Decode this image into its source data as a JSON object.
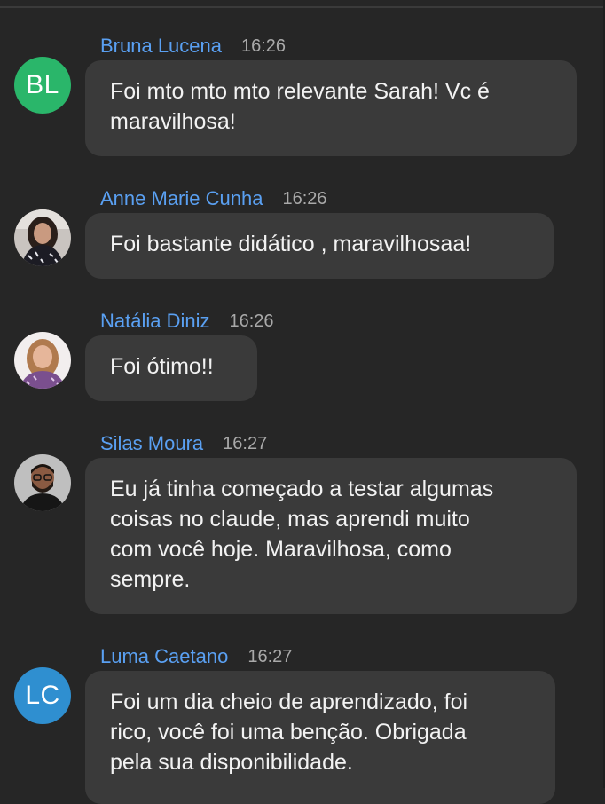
{
  "colors": {
    "background": "#262626",
    "bubble": "#3a3a3a",
    "sender_name": "#5aa0f2",
    "timestamp": "#a9a9a9",
    "message_text": "#f2f2f2"
  },
  "messages": [
    {
      "sender": "Bruna Lucena",
      "time": "16:26",
      "avatar": {
        "type": "initials",
        "initials": "BL",
        "color": "#2ab66a"
      },
      "lines": [
        "Foi mto mto mto relevante Sarah! Vc é",
        "maravilhosa!"
      ]
    },
    {
      "sender": "Anne Marie Cunha",
      "time": "16:26",
      "avatar": {
        "type": "photo",
        "icon": "user-photo-woman-dark-hair"
      },
      "lines": [
        "Foi bastante didático , maravilhosaa!"
      ]
    },
    {
      "sender": "Natália Diniz",
      "time": "16:26",
      "avatar": {
        "type": "photo",
        "icon": "user-photo-woman-light-hair"
      },
      "lines": [
        "Foi ótimo!!"
      ]
    },
    {
      "sender": "Silas Moura",
      "time": "16:27",
      "avatar": {
        "type": "photo",
        "icon": "user-photo-man-glasses"
      },
      "lines": [
        "Eu já tinha começado a testar algumas",
        "coisas no claude, mas aprendi muito",
        "com você hoje. Maravilhosa, como",
        "sempre."
      ]
    },
    {
      "sender": "Luma Caetano",
      "time": "16:27",
      "avatar": {
        "type": "initials",
        "initials": "LC",
        "color": "#2f8fd0"
      },
      "lines": [
        "Foi um dia cheio de aprendizado, foi",
        "rico, você foi uma benção. Obrigada",
        "pela sua disponibilidade."
      ]
    }
  ]
}
